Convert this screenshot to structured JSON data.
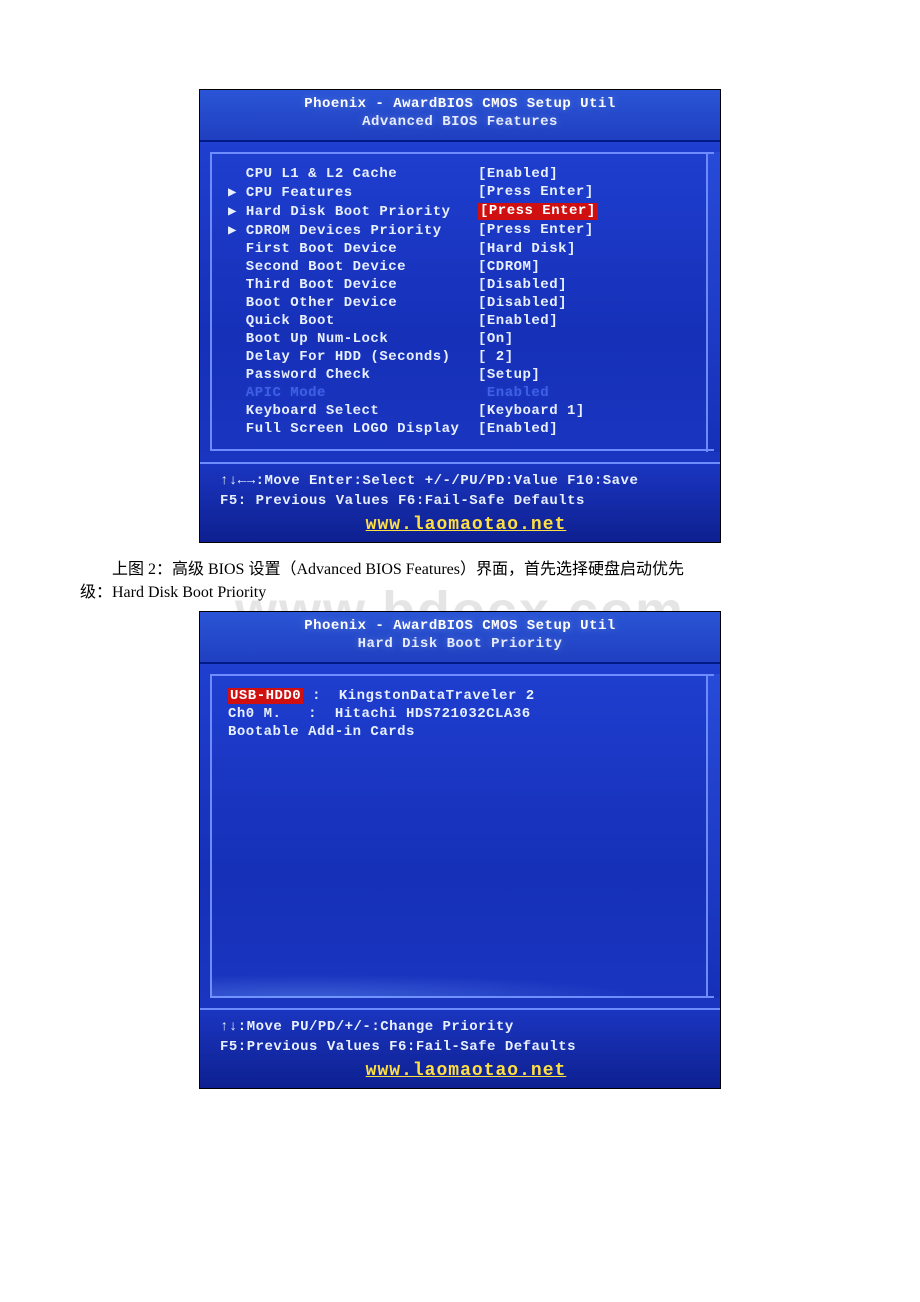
{
  "watermark": "www.bdocx.com",
  "bios1": {
    "title_line1": "Phoenix - AwardBIOS CMOS Setup Util",
    "title_line2": "Advanced BIOS Features",
    "rows": [
      {
        "marker": "",
        "label": "CPU L1 & L2 Cache",
        "value": "[Enabled]",
        "selected": false,
        "dim": false
      },
      {
        "marker": "▶",
        "label": "CPU Features",
        "value": "[Press Enter]",
        "selected": false,
        "dim": false
      },
      {
        "marker": "▶",
        "label": "Hard Disk Boot Priority",
        "value": "[Press Enter]",
        "selected": true,
        "dim": false
      },
      {
        "marker": "▶",
        "label": "CDROM Devices Priority",
        "value": "[Press Enter]",
        "selected": false,
        "dim": false
      },
      {
        "marker": "",
        "label": "First Boot Device",
        "value": "[Hard Disk]",
        "selected": false,
        "dim": false
      },
      {
        "marker": "",
        "label": "Second Boot Device",
        "value": "[CDROM]",
        "selected": false,
        "dim": false
      },
      {
        "marker": "",
        "label": "Third Boot Device",
        "value": "[Disabled]",
        "selected": false,
        "dim": false
      },
      {
        "marker": "",
        "label": "Boot Other Device",
        "value": "[Disabled]",
        "selected": false,
        "dim": false
      },
      {
        "marker": "",
        "label": "Quick Boot",
        "value": "[Enabled]",
        "selected": false,
        "dim": false
      },
      {
        "marker": "",
        "label": "Boot Up Num-Lock",
        "value": "[On]",
        "selected": false,
        "dim": false
      },
      {
        "marker": "",
        "label": "Delay For HDD (Seconds)",
        "value": "[ 2]",
        "selected": false,
        "dim": false
      },
      {
        "marker": "",
        "label": "Password Check",
        "value": "[Setup]",
        "selected": false,
        "dim": false
      },
      {
        "marker": "",
        "label": "APIC Mode",
        "value": " Enabled",
        "selected": false,
        "dim": true
      },
      {
        "marker": "",
        "label": "Keyboard Select",
        "value": "[Keyboard 1]",
        "selected": false,
        "dim": false
      },
      {
        "marker": "",
        "label": "Full Screen LOGO Display",
        "value": "[Enabled]",
        "selected": false,
        "dim": false
      }
    ],
    "footer_line1": "↑↓←→:Move  Enter:Select  +/-/PU/PD:Value  F10:Save",
    "footer_line2": "F5: Previous Values   F6:Fail-Safe Defaults",
    "footer_url": "www.laomaotao.net"
  },
  "caption_before": "上图 2：高级 BIOS 设置（Advanced BIOS Features）界面，首先选择硬盘启动优先",
  "caption_line2": "级：Hard Disk Boot Priority",
  "bios2": {
    "title_line1": "Phoenix - AwardBIOS CMOS Setup Util",
    "title_line2": "Hard Disk Boot Priority",
    "items": [
      {
        "left": "USB-HDD0",
        "sep": " :  ",
        "right": "KingstonDataTraveler 2",
        "highlight": true
      },
      {
        "left": "Ch0 M.",
        "sep": "   :  ",
        "right": "Hitachi HDS721032CLA36",
        "highlight": false
      },
      {
        "left": "Bootable Add-in Cards",
        "sep": "",
        "right": "",
        "highlight": false
      }
    ],
    "footer_line1": "↑↓:Move      PU/PD/+/-:Change Priority",
    "footer_line2": "F5:Previous Values   F6:Fail-Safe Defaults",
    "footer_url": "www.laomaotao.net"
  }
}
